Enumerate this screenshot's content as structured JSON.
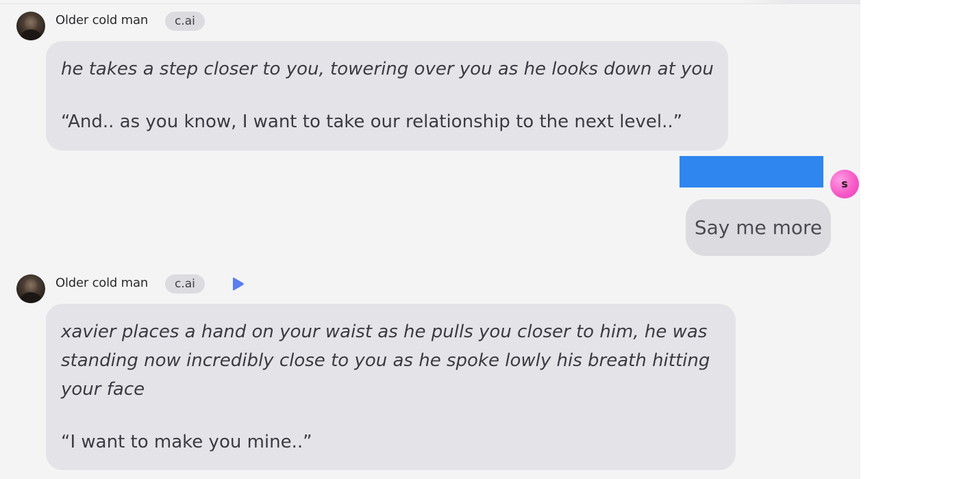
{
  "messages": [
    {
      "sender": "Older cold man",
      "badge": "c.ai",
      "action_lines": [
        "he takes a step closer to you, towering over you as he looks down at you"
      ],
      "speech": "“And.. as you know, I want to take our relationship to the next level..”"
    },
    {
      "sender": "Older cold man",
      "badge": "c.ai",
      "action_lines": [
        "xavier places a hand on your waist as he pulls you closer to him, he was",
        "standing now incredibly close to you as he spoke lowly his breath hitting",
        "your face"
      ],
      "speech": "“I want to make you mine..”"
    }
  ],
  "user_message": {
    "text": "Say me more",
    "avatar_initial": "s"
  },
  "icons": {
    "play": "play-icon",
    "avatar": "character-avatar"
  },
  "colors": {
    "background": "#f4f4f4",
    "bubble": "#e4e4e8",
    "badge": "#dcdce0",
    "play_icon": "#5a7cf5",
    "redaction": "#2f86ef",
    "user_avatar": "#f75ac8"
  }
}
